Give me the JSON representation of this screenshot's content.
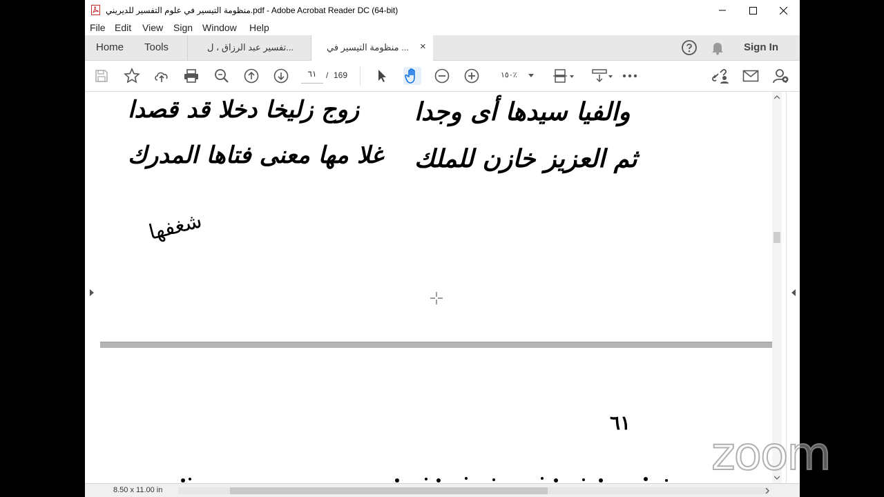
{
  "window": {
    "title": "منظومة التيسير في علوم التفسير للديريني.pdf - Adobe Acrobat Reader DC (64-bit)"
  },
  "menu": [
    "File",
    "Edit",
    "View",
    "Sign",
    "Window",
    "Help"
  ],
  "tabs": {
    "home": "Home",
    "tools": "Tools",
    "doc1": "تفسير عبد الرزاق ، ل...",
    "doc2": "منظومة التيسير في ...",
    "close_glyph": "×",
    "sign_in": "Sign In"
  },
  "toolbar": {
    "current_page": "٦١",
    "page_separator": "/",
    "total_pages": "169",
    "zoom": "١٥٠٪"
  },
  "document": {
    "page1_line1_left": "زوج زليخا دخلا قد قصدا",
    "page1_line1_right": "والفيا سيدها أى وجدا",
    "page1_line2_left": "غلا مها معنى فتاها المدرك",
    "page1_line2_right": "ثم العزيز خازن للملك",
    "page1_annotation": "شغفها",
    "page2_number": "٦١"
  },
  "status": {
    "page_size": "8.50 x 11.00 in"
  },
  "overlay": {
    "logo": "zoom"
  },
  "colors": {
    "acrobat_red": "#d32f2f",
    "accent_blue": "#1473e6"
  }
}
